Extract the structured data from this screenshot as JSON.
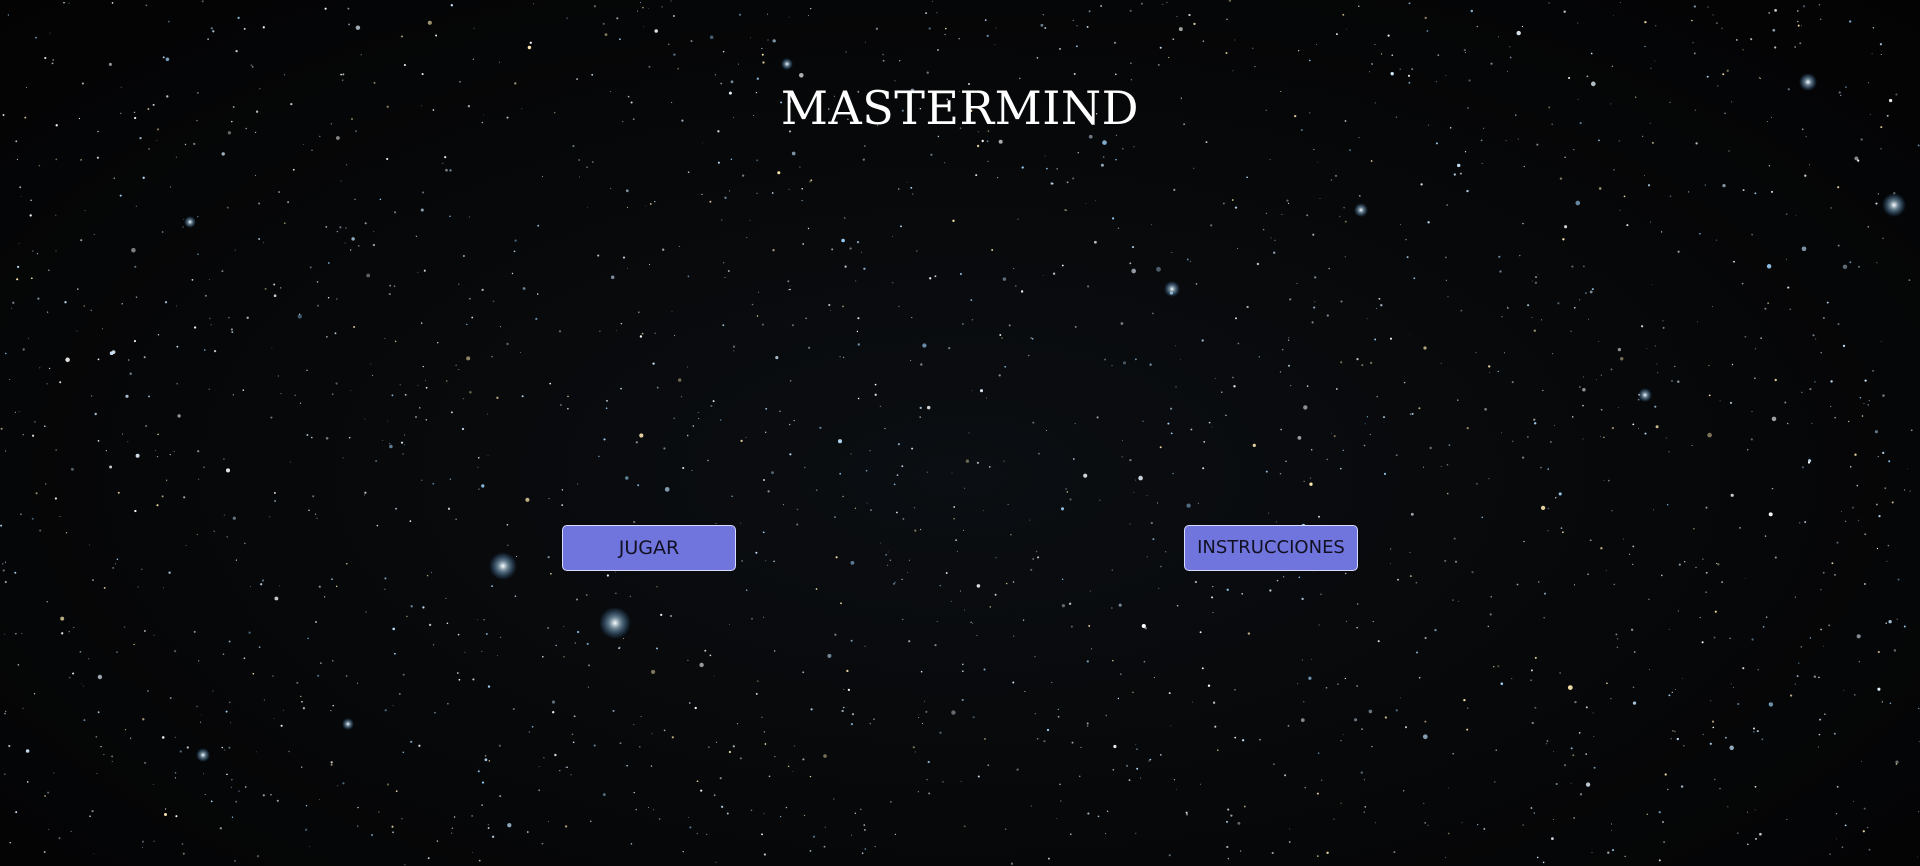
{
  "title": "MASTERMIND",
  "menu": {
    "play_label": "JUGAR",
    "instructions_label": "INSTRUCCIONES"
  },
  "colors": {
    "button_fill": "#7074dd",
    "button_border": "#d9dbff",
    "title_text": "#ffffff",
    "background": "#060708"
  }
}
